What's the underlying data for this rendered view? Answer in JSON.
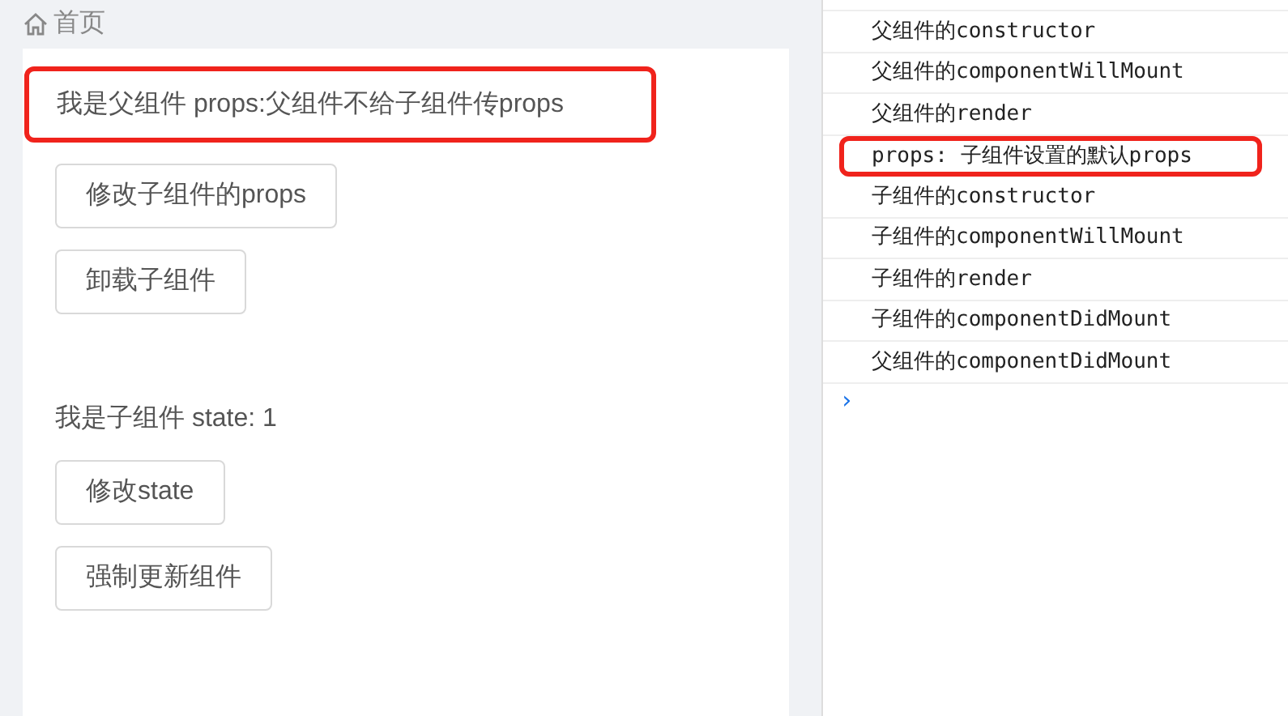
{
  "breadcrumb": {
    "label": "首页"
  },
  "parent": {
    "text": "我是父组件 props:父组件不给子组件传props",
    "highlighted": true,
    "buttons": [
      "修改子组件的props",
      "卸载子组件"
    ]
  },
  "child": {
    "text": "我是子组件 state: 1",
    "buttons": [
      "修改state",
      "强制更新组件"
    ]
  },
  "console": {
    "lines": [
      {
        "text": "父组件的constructor",
        "highlighted": false
      },
      {
        "text": "父组件的componentWillMount",
        "highlighted": false
      },
      {
        "text": "父组件的render",
        "highlighted": false
      },
      {
        "text": "props: 子组件设置的默认props",
        "highlighted": true
      },
      {
        "text": "子组件的constructor",
        "highlighted": false
      },
      {
        "text": "子组件的componentWillMount",
        "highlighted": false
      },
      {
        "text": "子组件的render",
        "highlighted": false
      },
      {
        "text": "子组件的componentDidMount",
        "highlighted": false
      },
      {
        "text": "父组件的componentDidMount",
        "highlighted": false
      }
    ],
    "prompt": "›"
  }
}
